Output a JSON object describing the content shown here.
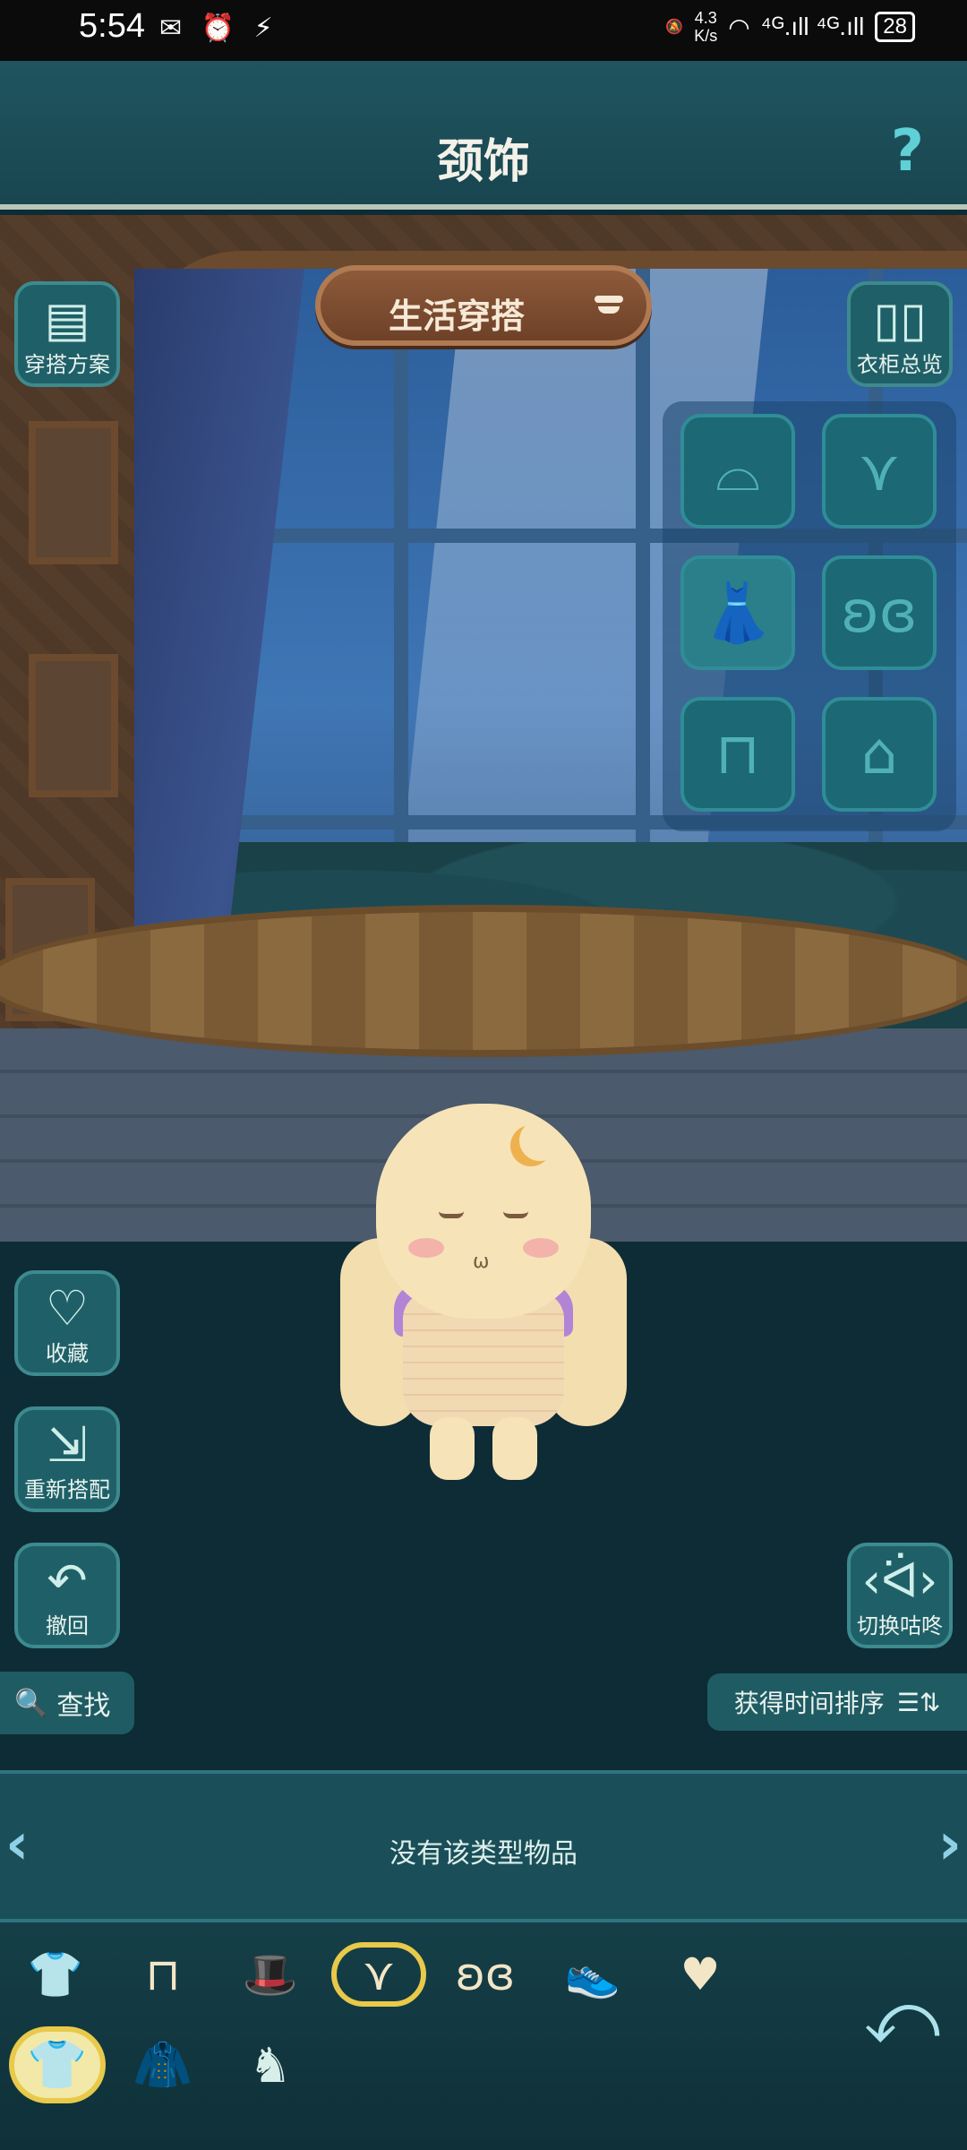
{
  "status_bar": {
    "time": "5:54",
    "left_icons": "✉ ⏰ ⚡",
    "net_speed_value": "4.3",
    "net_speed_unit": "K/s",
    "signal": "⁴ᴳ.ıll ⁴ᴳ.ıll",
    "battery": "28"
  },
  "header": {
    "title": "颈饰",
    "help": "?"
  },
  "outfit_sign": {
    "label": "生活穿搭"
  },
  "side_buttons": {
    "outfit_plan": "穿搭方案",
    "wardrobe_overview": "衣柜总览",
    "favorite": "收藏",
    "rematch": "重新搭配",
    "undo": "撤回",
    "switch_character": "切换咕咚"
  },
  "slots": [
    {
      "name": "hat",
      "icon": "hat-icon"
    },
    {
      "name": "necklace",
      "icon": "necklace-icon"
    },
    {
      "name": "top",
      "icon": "dress-icon"
    },
    {
      "name": "wings",
      "icon": "wings-icon"
    },
    {
      "name": "pants",
      "icon": "pants-icon"
    },
    {
      "name": "shoes",
      "icon": "shoes-icon"
    }
  ],
  "search": {
    "label": "查找"
  },
  "sort": {
    "label": "获得时间排序"
  },
  "items": {
    "empty_message": "没有该类型物品"
  },
  "categories": [
    {
      "name": "top",
      "icon": "shirt-icon"
    },
    {
      "name": "pants",
      "icon": "pants-icon"
    },
    {
      "name": "hat",
      "icon": "hat-icon"
    },
    {
      "name": "necklace",
      "icon": "necklace-icon",
      "active": true
    },
    {
      "name": "wings",
      "icon": "wings-icon"
    },
    {
      "name": "shoes",
      "icon": "shoes-icon"
    },
    {
      "name": "favorite",
      "icon": "heart-icon"
    }
  ],
  "subtabs": [
    {
      "name": "clothes",
      "active": true
    },
    {
      "name": "suit"
    },
    {
      "name": "pose"
    }
  ],
  "colors": {
    "accent": "#e8c94a",
    "panel": "#1f5b63",
    "header": "#1f5560"
  }
}
